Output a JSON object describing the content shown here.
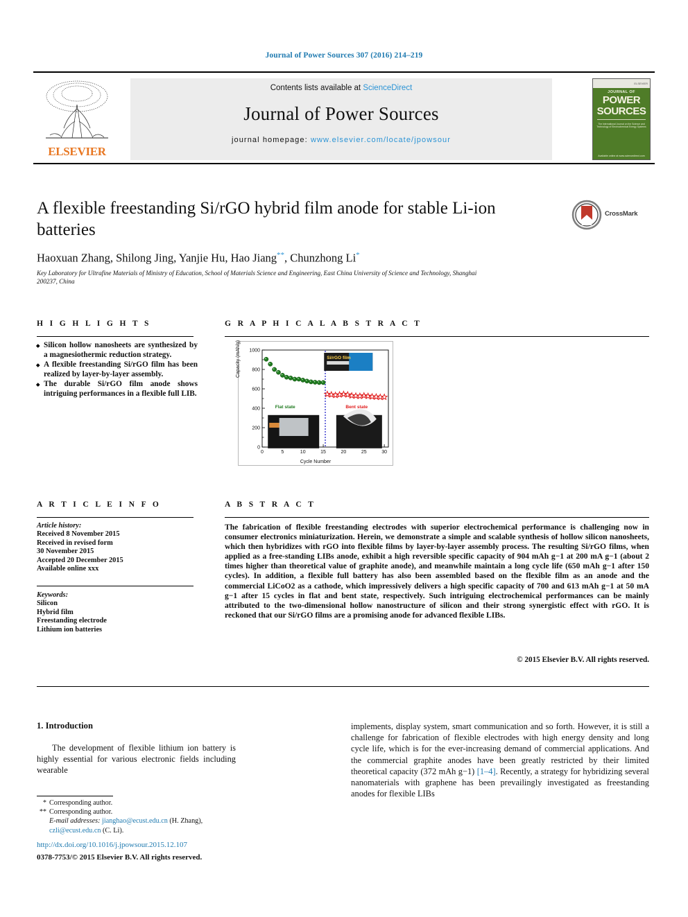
{
  "running_head": "Journal of Power Sources 307 (2016) 214–219",
  "masthead": {
    "contents_prefix": "Contents lists available at ",
    "sciencedirect": "ScienceDirect",
    "journal_name": "Journal of Power Sources",
    "homepage_prefix": "journal homepage: ",
    "homepage_url": "www.elsevier.com/locate/jpowsour",
    "publisher": "ELSEVIER",
    "cover": {
      "kicker": "JOURNAL OF",
      "line1": "POWER",
      "line2": "SOURCES",
      "blurb": "The International Journal on the Science and Technology of Electrochemical Energy Systems",
      "footer": "Available online at www.sciencedirect.com"
    }
  },
  "article": {
    "title": "A flexible freestanding Si/rGO hybrid film anode for stable Li-ion batteries",
    "crossmark_label": "CrossMark",
    "authors": "Haoxuan Zhang, Shilong Jing, Yanjie Hu, Hao Jiang",
    "authors_tail": ", Chunzhong Li",
    "marker_jiang": "**",
    "marker_li": "*",
    "affiliation": "Key Laboratory for Ultrafine Materials of Ministry of Education, School of Materials Science and Engineering, East China University of Science and Technology, Shanghai 200237, China"
  },
  "highlights": {
    "heading": "H I G H L I G H T S",
    "items": [
      "Silicon hollow nanosheets are synthesized by a magnesiothermic reduction strategy.",
      "A flexible freestanding Si/rGO film has been realized by layer-by-layer assembly.",
      "The durable Si/rGO film anode shows intriguing performances in a flexible full LIB."
    ]
  },
  "graphical_abstract": {
    "heading": "G R A P H I C A L   A B S T R A C T"
  },
  "article_info": {
    "heading": "A R T I C L E   I N F O",
    "history_label": "Article history:",
    "history": [
      "Received 8 November 2015",
      "Received in revised form",
      "30 November 2015",
      "Accepted 20 December 2015",
      "Available online xxx"
    ],
    "keywords_label": "Keywords:",
    "keywords": [
      "Silicon",
      "Hybrid film",
      "Freestanding electrode",
      "Lithium ion batteries"
    ]
  },
  "abstract": {
    "heading": "A B S T R A C T",
    "text": "The fabrication of flexible freestanding electrodes with superior electrochemical performance is challenging now in consumer electronics miniaturization. Herein, we demonstrate a simple and scalable synthesis of hollow silicon nanosheets, which then hybridizes with rGO into flexible films by layer-by-layer assembly process. The resulting Si/rGO films, when applied as a free-standing LIBs anode, exhibit a high reversible specific capacity of 904 mAh g−1 at 200 mA g−1 (about 2 times higher than theoretical value of graphite anode), and meanwhile maintain a long cycle life (650 mAh g−1 after 150 cycles). In addition, a flexible full battery has also been assembled based on the flexible film as an anode and the commercial LiCoO2 as a cathode, which impressively delivers a high specific capacity of 700 and 613 mAh g−1 at 50 mA g−1 after 15 cycles in flat and bent state, respectively. Such intriguing electrochemical performances can be mainly attributed to the two-dimensional hollow nanostructure of silicon and their strong synergistic effect with rGO. It is reckoned that our Si/rGO films are a promising anode for advanced flexible LIBs.",
    "copyright": "© 2015 Elsevier B.V. All rights reserved."
  },
  "body": {
    "section_number_title": "1. Introduction",
    "left_paragraph": "The development of flexible lithium ion battery is highly essential for various electronic fields including wearable",
    "right_paragraph_a": "implements, display system, smart communication and so forth. However, it is still a challenge for fabrication of flexible electrodes with high energy density and long cycle life, which is for the ever-increasing demand of commercial applications. And the commercial graphite anodes have been greatly restricted by their limited theoretical capacity (372 mAh g−1) ",
    "right_reference": "[1–4]",
    "right_paragraph_b": ". Recently, a strategy for hybridizing several nanomaterials with graphene has been prevailingly investigated as freestanding anodes for flexible LIBs"
  },
  "footnotes": {
    "line1_marker": "*",
    "line1": "Corresponding author.",
    "line2_marker": "**",
    "line2": "Corresponding author.",
    "email_label": "E-mail addresses:",
    "email1": "jianghao@ecust.edu.cn",
    "email1_name": " (H. Zhang), ",
    "email2": "czli@ecust.edu.cn",
    "email2_name": " (C. Li).",
    "doi": "http://dx.doi.org/10.1016/j.jpowsour.2015.12.107",
    "issn": "0378-7753/© 2015 Elsevier B.V. All rights reserved."
  },
  "chart_data": {
    "type": "scatter",
    "title": "",
    "xlabel": "Cycle Number",
    "ylabel": "Capacity (mAh/g)",
    "xlim": [
      0,
      31
    ],
    "ylim": [
      0,
      1000
    ],
    "xticks": [
      0,
      5,
      10,
      15,
      20,
      25,
      30
    ],
    "yticks": [
      0,
      200,
      400,
      600,
      800,
      1000
    ],
    "grid": false,
    "legend_position": "none",
    "annotations": [
      {
        "text": "Si/rGO film",
        "color": "#ffd24d"
      },
      {
        "text": "Flat state",
        "color": "#1f7a1f"
      },
      {
        "text": "Bent state",
        "color": "#e01b1b"
      }
    ],
    "divider_x": 15.5,
    "series": [
      {
        "name": "Flat state",
        "color": "#1f7a1f",
        "marker": "circle",
        "x": [
          1,
          2,
          3,
          4,
          5,
          6,
          7,
          8,
          9,
          10,
          11,
          12,
          13,
          14,
          15
        ],
        "y": [
          905,
          855,
          800,
          770,
          740,
          720,
          712,
          700,
          700,
          690,
          680,
          672,
          668,
          665,
          665
        ]
      },
      {
        "name": "Bent state",
        "color": "#e01b1b",
        "marker": "star",
        "x": [
          16,
          17,
          18,
          19,
          20,
          21,
          22,
          23,
          24,
          25,
          26,
          27,
          28,
          29,
          30
        ],
        "y": [
          545,
          540,
          535,
          540,
          545,
          540,
          530,
          528,
          525,
          530,
          525,
          520,
          518,
          515,
          515
        ]
      }
    ]
  }
}
